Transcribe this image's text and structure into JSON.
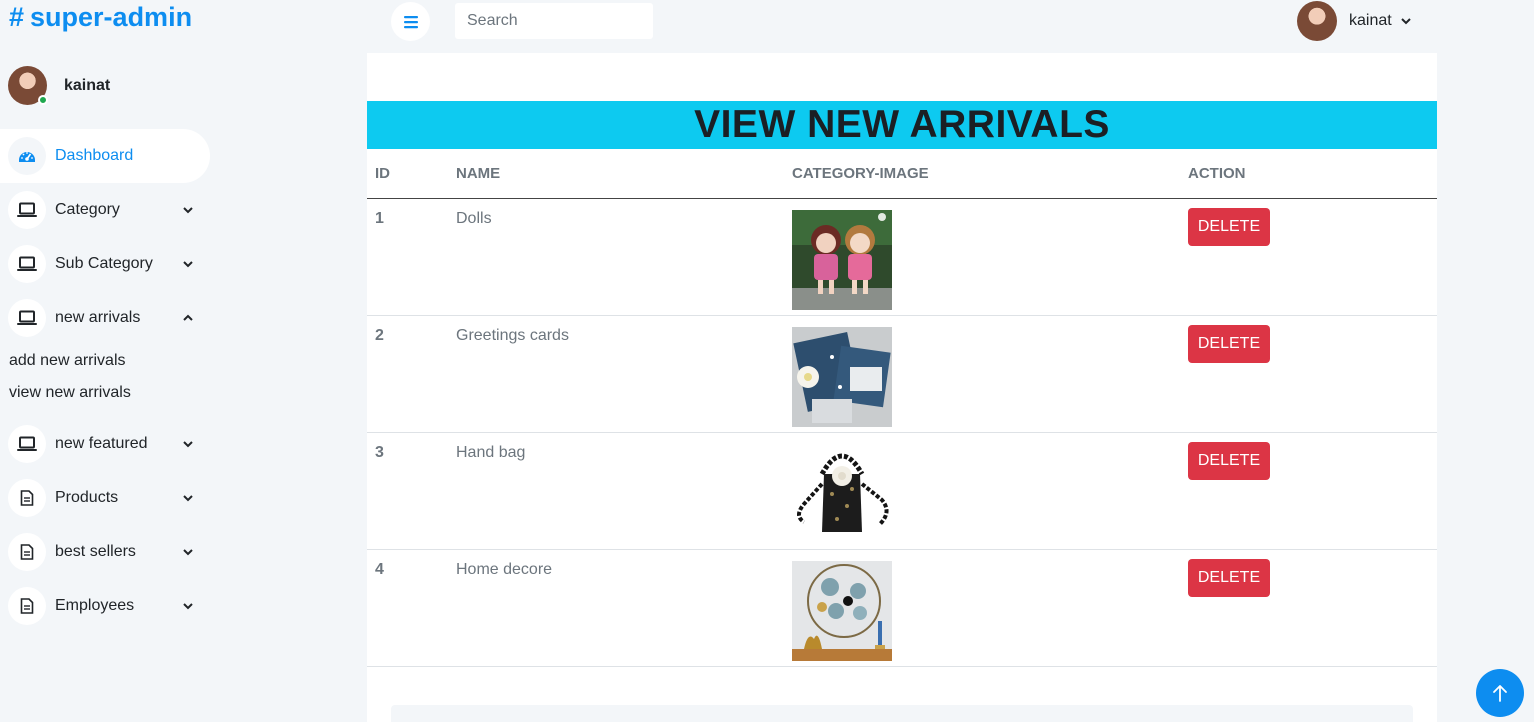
{
  "brand": {
    "symbol": "#",
    "name": "super-admin"
  },
  "sidebar": {
    "user_name": "kainat",
    "items": [
      {
        "label": "Dashboard",
        "icon": "speedometer-icon",
        "active": true
      },
      {
        "label": "Category",
        "icon": "laptop-icon",
        "expanded": false
      },
      {
        "label": "Sub Category",
        "icon": "laptop-icon",
        "expanded": false
      },
      {
        "label": "new arrivals",
        "icon": "laptop-icon",
        "expanded": true,
        "children": [
          "add new arrivals",
          "view new arrivals"
        ]
      },
      {
        "label": "new featured",
        "icon": "laptop-icon",
        "expanded": false
      },
      {
        "label": "Products",
        "icon": "document-icon",
        "expanded": false
      },
      {
        "label": "best sellers",
        "icon": "document-icon",
        "expanded": false
      },
      {
        "label": "Employees",
        "icon": "document-icon",
        "expanded": false
      }
    ]
  },
  "topbar": {
    "search_placeholder": "Search",
    "user_name": "kainat"
  },
  "page": {
    "title": "VIEW NEW ARRIVALS",
    "columns": [
      "ID",
      "NAME",
      "CATEGORY-IMAGE",
      "ACTION"
    ],
    "delete_label": "DELETE",
    "rows": [
      {
        "id": "1",
        "name": "Dolls",
        "image": "dolls-photo"
      },
      {
        "id": "2",
        "name": "Greetings cards",
        "image": "greeting-cards-photo"
      },
      {
        "id": "3",
        "name": "Hand bag",
        "image": "beaded-handbag-photo"
      },
      {
        "id": "4",
        "name": "Home decore",
        "image": "wall-decor-photo"
      }
    ]
  },
  "colors": {
    "accent": "#0d8df0",
    "banner": "#0dcaf0",
    "danger": "#dc3545",
    "online": "#1fa84f"
  }
}
